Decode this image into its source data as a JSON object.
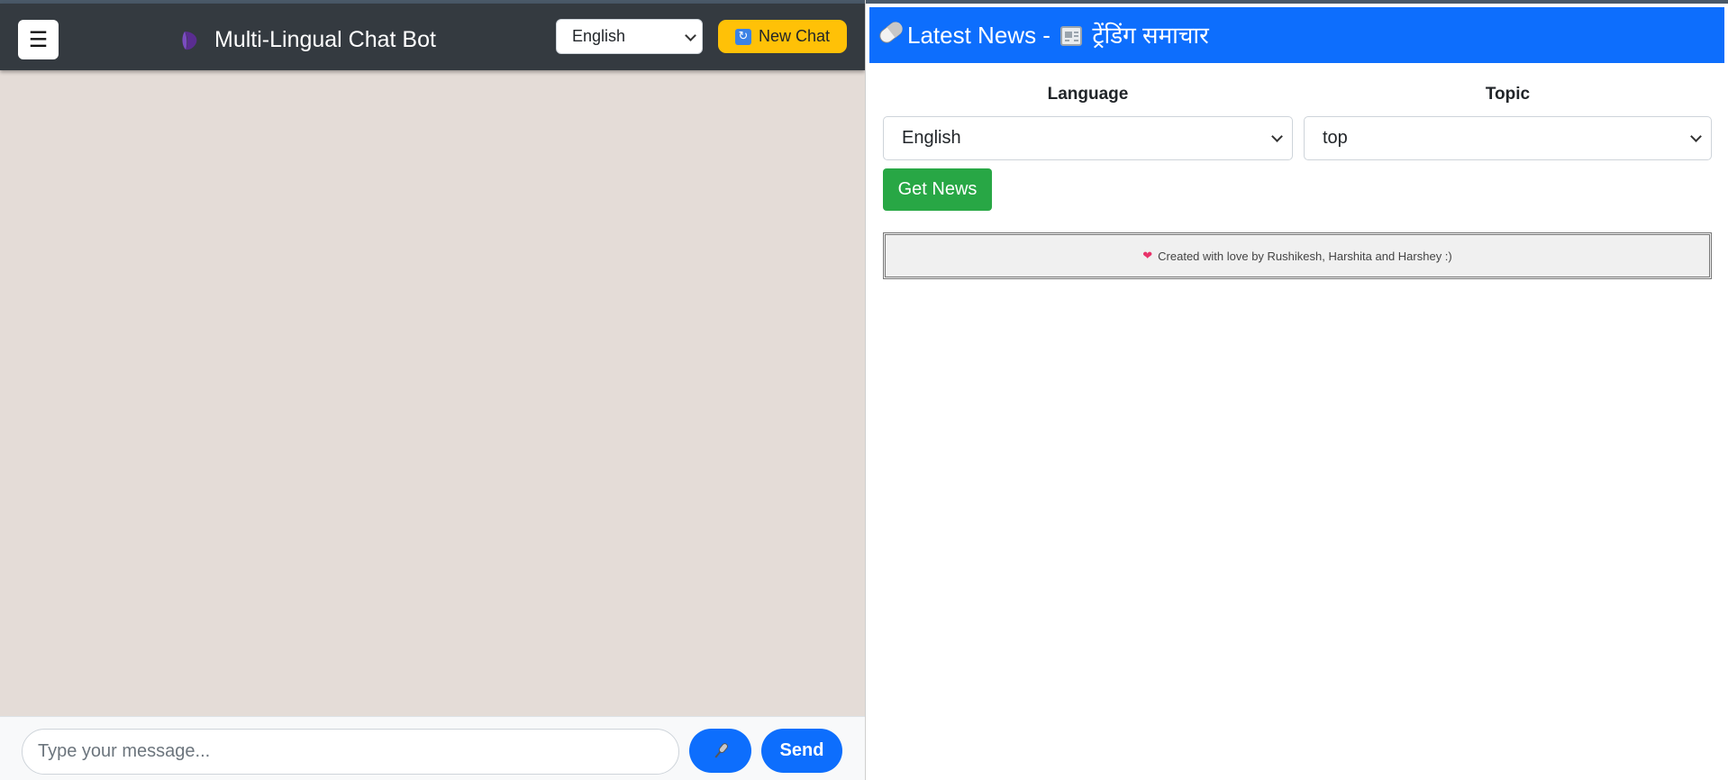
{
  "chat": {
    "app_title": "Multi-Lingual Chat Bot",
    "menu_glyph": "☰",
    "language_selected": "English",
    "new_chat_label": "New Chat",
    "refresh_glyph": "🔄",
    "message_placeholder": "Type your message...",
    "send_label": "Send",
    "colors": {
      "header_bg": "#343a40",
      "chat_bg": "#e4dcd7",
      "new_chat_bg": "#ffc107",
      "primary": "#0d6efd"
    }
  },
  "news": {
    "title_prefix": "Latest News -",
    "title_hindi": "ट्रेंडिंग समाचार",
    "language_label": "Language",
    "topic_label": "Topic",
    "language_selected": "English",
    "topic_selected": "top",
    "get_news_label": "Get News",
    "footer_text": "Created with love by Rushikesh, Harshita and Harshey :)",
    "heart_glyph": "❤",
    "colors": {
      "header_bg": "#0d6efd",
      "button_bg": "#28a745"
    }
  },
  "icons": [
    "menu-icon",
    "logo-icon",
    "chevron-down-icon",
    "refresh-icon",
    "mic-icon",
    "pill-icon",
    "newspaper-icon",
    "heart-icon"
  ]
}
